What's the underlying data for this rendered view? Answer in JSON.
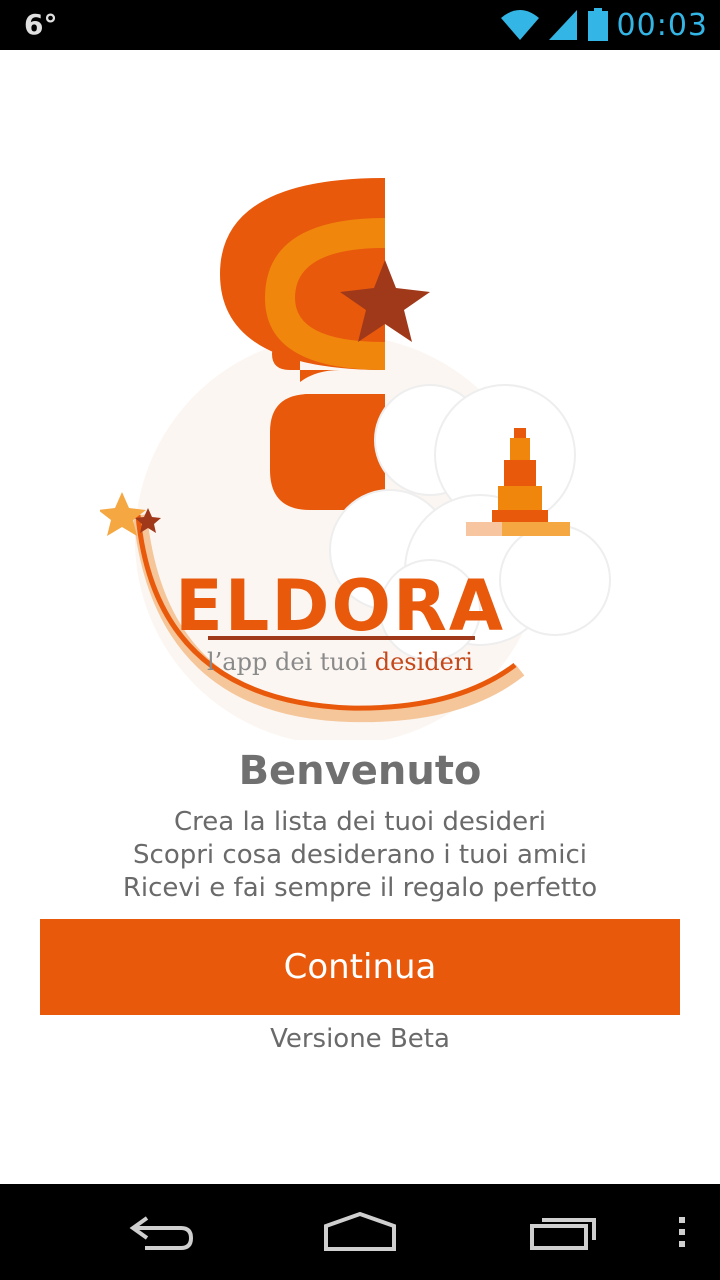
{
  "status_bar": {
    "temperature": "6°",
    "time": "00:03",
    "icons": [
      "wifi-icon",
      "signal-icon",
      "battery-icon"
    ],
    "time_color": "#33b5e5"
  },
  "logo": {
    "name": "ELDORA",
    "tagline_regular": "l’app dei tuoi ",
    "tagline_accent": "desideri",
    "colors": {
      "orange": "#e8590c",
      "light_orange": "#f0860c",
      "star_dark": "#a0381a",
      "star_light": "#f5a742"
    }
  },
  "welcome": {
    "title": "Benvenuto",
    "line1": "Crea la lista dei tuoi desideri",
    "line2": "Scopri cosa desiderano i tuoi amici",
    "line3": "Ricevi e fai sempre il regalo perfetto"
  },
  "continue_button": {
    "label": "Continua",
    "color": "#e8590c"
  },
  "version_label": "Versione Beta",
  "nav_bar": {
    "icons": [
      "back-icon",
      "home-icon",
      "recent-apps-icon",
      "overflow-menu-icon"
    ]
  }
}
